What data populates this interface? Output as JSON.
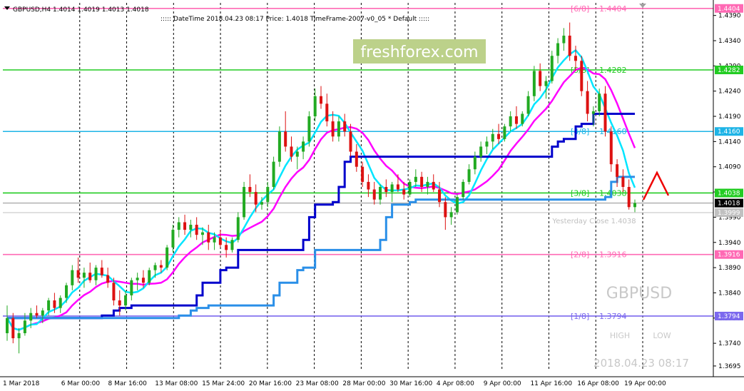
{
  "header": {
    "symbol_line": "GBPUSD,H4  1.4014 1.4019 1.4013 1.4018",
    "info_line": "::::: DateTime  2018.04.23 08:17    Price: 1.4018    TimeFrame-2007-v0_05    *   Default   :::::"
  },
  "watermark": "freshforex.com",
  "symbol_name": "GBPUSD",
  "timestamp": "2018.04.23 08:17",
  "high_label": "HIGH",
  "low_label": "LOW",
  "yesterday_close": "Yesterday Close 1.4038",
  "colors": {
    "bull": "#22aa22",
    "bear": "#dd1111",
    "cyan": "#00e5ff",
    "magenta": "#ff00ff",
    "navy": "#0000cc",
    "sky": "#2a8fe8",
    "red": "#ee0000"
  },
  "chart_data": {
    "type": "candlestick",
    "symbol": "GBPUSD",
    "timeframe": "H4",
    "ylim": [
      1.3685,
      1.4415
    ],
    "y_ticks": [
      "1.4390",
      "1.4340",
      "1.4290",
      "1.4240",
      "1.4190",
      "1.4140",
      "1.4090",
      "1.4040",
      "1.3990",
      "1.3940",
      "1.3890",
      "1.3840",
      "1.3790",
      "1.3740",
      "1.3695"
    ],
    "x_ticks": [
      "1 Mar 2018",
      "6 Mar 00:00",
      "8 Mar 16:00",
      "13 Mar 08:00",
      "15 Mar 24:00",
      "20 Mar 16:00",
      "23 Mar 08:00",
      "28 Mar 00:00",
      "30 Mar 16:00",
      "4 Apr 08:00",
      "9 Apr 00:00",
      "11 Apr 16:00",
      "16 Apr 08:00",
      "19 Apr 00:00"
    ],
    "levels": [
      {
        "label": "[6/8]",
        "value": "1.4404",
        "color": "#ff69b4",
        "tag": "1.4404"
      },
      {
        "label": "[5/8]",
        "value": "1.4282",
        "color": "#22cc22",
        "tag": "1.4282"
      },
      {
        "label": "[4/8]",
        "value": "1.4160",
        "color": "#1eb4e6",
        "tag": "1.4160"
      },
      {
        "label": "[3/8]",
        "value": "1.4038",
        "color": "#22cc22",
        "tag": "1.4038"
      },
      {
        "label": "[2/8]",
        "value": "1.3916",
        "color": "#ff69b4",
        "tag": "1.3916"
      },
      {
        "label": "[1/8]",
        "value": "1.3794",
        "color": "#7b68ee",
        "tag": "1.3794"
      }
    ],
    "price_tags": [
      {
        "value": "1.4018",
        "bg": "#000000"
      },
      {
        "value": "1.3999",
        "bg": "#c0c0c0"
      }
    ],
    "current_price": 1.4018,
    "yesterday_close": 1.3999,
    "candles": [
      [
        1.376,
        1.3815,
        1.3745,
        1.379
      ],
      [
        1.379,
        1.38,
        1.374,
        1.375
      ],
      [
        1.375,
        1.377,
        1.372,
        1.376
      ],
      [
        1.376,
        1.38,
        1.3755,
        1.3785
      ],
      [
        1.3785,
        1.381,
        1.377,
        1.38
      ],
      [
        1.38,
        1.3815,
        1.379,
        1.3795
      ],
      [
        1.3795,
        1.381,
        1.378,
        1.3805
      ],
      [
        1.3805,
        1.383,
        1.3795,
        1.3825
      ],
      [
        1.3825,
        1.384,
        1.38,
        1.381
      ],
      [
        1.381,
        1.3835,
        1.38,
        1.383
      ],
      [
        1.383,
        1.386,
        1.382,
        1.3855
      ],
      [
        1.3855,
        1.3895,
        1.3845,
        1.3885
      ],
      [
        1.3885,
        1.391,
        1.386,
        1.387
      ],
      [
        1.387,
        1.389,
        1.385,
        1.388
      ],
      [
        1.388,
        1.39,
        1.386,
        1.3865
      ],
      [
        1.3865,
        1.3895,
        1.3855,
        1.389
      ],
      [
        1.389,
        1.3905,
        1.387,
        1.3875
      ],
      [
        1.3875,
        1.389,
        1.385,
        1.386
      ],
      [
        1.386,
        1.387,
        1.3815,
        1.3825
      ],
      [
        1.3825,
        1.3845,
        1.3795,
        1.3815
      ],
      [
        1.3815,
        1.3845,
        1.3805,
        1.3835
      ],
      [
        1.3835,
        1.387,
        1.3825,
        1.3865
      ],
      [
        1.3865,
        1.388,
        1.3845,
        1.387
      ],
      [
        1.387,
        1.3885,
        1.385,
        1.386
      ],
      [
        1.386,
        1.389,
        1.3855,
        1.3885
      ],
      [
        1.3885,
        1.39,
        1.387,
        1.3895
      ],
      [
        1.3895,
        1.3905,
        1.388,
        1.389
      ],
      [
        1.389,
        1.3935,
        1.3885,
        1.393
      ],
      [
        1.393,
        1.3975,
        1.392,
        1.3965
      ],
      [
        1.3965,
        1.399,
        1.395,
        1.398
      ],
      [
        1.398,
        1.3995,
        1.3955,
        1.3965
      ],
      [
        1.3965,
        1.3985,
        1.395,
        1.3975
      ],
      [
        1.3975,
        1.399,
        1.3945,
        1.3955
      ],
      [
        1.3955,
        1.397,
        1.3935,
        1.396
      ],
      [
        1.396,
        1.3975,
        1.3925,
        1.394
      ],
      [
        1.394,
        1.396,
        1.3925,
        1.395
      ],
      [
        1.395,
        1.3965,
        1.393,
        1.3935
      ],
      [
        1.3935,
        1.395,
        1.391,
        1.3925
      ],
      [
        1.3925,
        1.395,
        1.392,
        1.3945
      ],
      [
        1.3945,
        1.4,
        1.394,
        1.399
      ],
      [
        1.399,
        1.406,
        1.3985,
        1.405
      ],
      [
        1.405,
        1.4075,
        1.403,
        1.404
      ],
      [
        1.404,
        1.4055,
        1.4,
        1.4015
      ],
      [
        1.4015,
        1.403,
        1.4005,
        1.402
      ],
      [
        1.402,
        1.406,
        1.401,
        1.405
      ],
      [
        1.405,
        1.411,
        1.4045,
        1.41
      ],
      [
        1.41,
        1.417,
        1.409,
        1.416
      ],
      [
        1.416,
        1.42,
        1.412,
        1.413
      ],
      [
        1.413,
        1.415,
        1.41,
        1.411
      ],
      [
        1.411,
        1.413,
        1.4085,
        1.412
      ],
      [
        1.412,
        1.415,
        1.4105,
        1.414
      ],
      [
        1.414,
        1.42,
        1.413,
        1.419
      ],
      [
        1.419,
        1.4245,
        1.418,
        1.423
      ],
      [
        1.423,
        1.425,
        1.4205,
        1.4215
      ],
      [
        1.4215,
        1.4235,
        1.417,
        1.418
      ],
      [
        1.418,
        1.42,
        1.414,
        1.415
      ],
      [
        1.415,
        1.419,
        1.414,
        1.418
      ],
      [
        1.418,
        1.4195,
        1.415,
        1.416
      ],
      [
        1.416,
        1.4175,
        1.411,
        1.412
      ],
      [
        1.412,
        1.4135,
        1.408,
        1.409
      ],
      [
        1.409,
        1.41,
        1.405,
        1.406
      ],
      [
        1.406,
        1.4075,
        1.403,
        1.4045
      ],
      [
        1.4045,
        1.406,
        1.4015,
        1.4025
      ],
      [
        1.4025,
        1.4055,
        1.4015,
        1.405
      ],
      [
        1.405,
        1.4065,
        1.403,
        1.404
      ],
      [
        1.404,
        1.406,
        1.402,
        1.4055
      ],
      [
        1.4055,
        1.4075,
        1.404,
        1.4045
      ],
      [
        1.4045,
        1.406,
        1.4025,
        1.4035
      ],
      [
        1.4035,
        1.4065,
        1.403,
        1.406
      ],
      [
        1.406,
        1.4085,
        1.405,
        1.407
      ],
      [
        1.407,
        1.408,
        1.404,
        1.405
      ],
      [
        1.405,
        1.407,
        1.4035,
        1.406
      ],
      [
        1.406,
        1.4075,
        1.404,
        1.4045
      ],
      [
        1.4045,
        1.406,
        1.401,
        1.402
      ],
      [
        1.402,
        1.403,
        1.3965,
        1.399
      ],
      [
        1.399,
        1.401,
        1.3975,
        1.4
      ],
      [
        1.4,
        1.4035,
        1.3995,
        1.403
      ],
      [
        1.403,
        1.4065,
        1.4025,
        1.406
      ],
      [
        1.406,
        1.4095,
        1.4055,
        1.4085
      ],
      [
        1.4085,
        1.412,
        1.4075,
        1.411
      ],
      [
        1.411,
        1.414,
        1.41,
        1.413
      ],
      [
        1.413,
        1.415,
        1.4115,
        1.414
      ],
      [
        1.414,
        1.4165,
        1.4125,
        1.4155
      ],
      [
        1.4155,
        1.4175,
        1.4135,
        1.4145
      ],
      [
        1.4145,
        1.4175,
        1.414,
        1.417
      ],
      [
        1.417,
        1.42,
        1.416,
        1.419
      ],
      [
        1.419,
        1.421,
        1.4165,
        1.4175
      ],
      [
        1.4175,
        1.42,
        1.417,
        1.4195
      ],
      [
        1.4195,
        1.424,
        1.419,
        1.423
      ],
      [
        1.423,
        1.429,
        1.422,
        1.428
      ],
      [
        1.428,
        1.4295,
        1.424,
        1.425
      ],
      [
        1.425,
        1.427,
        1.4225,
        1.426
      ],
      [
        1.426,
        1.432,
        1.4255,
        1.431
      ],
      [
        1.431,
        1.4345,
        1.4295,
        1.4335
      ],
      [
        1.4335,
        1.4365,
        1.432,
        1.435
      ],
      [
        1.435,
        1.4376,
        1.43,
        1.431
      ],
      [
        1.431,
        1.433,
        1.428,
        1.43
      ],
      [
        1.43,
        1.431,
        1.423,
        1.424
      ],
      [
        1.424,
        1.426,
        1.418,
        1.4195
      ],
      [
        1.4195,
        1.421,
        1.417,
        1.42
      ],
      [
        1.42,
        1.4245,
        1.419,
        1.4235
      ],
      [
        1.4235,
        1.425,
        1.415,
        1.416
      ],
      [
        1.416,
        1.417,
        1.408,
        1.4095
      ],
      [
        1.4095,
        1.4105,
        1.405,
        1.407
      ],
      [
        1.407,
        1.4085,
        1.404,
        1.405
      ],
      [
        1.405,
        1.4065,
        1.4005,
        1.401
      ],
      [
        1.401,
        1.4025,
        1.4,
        1.4018
      ]
    ]
  }
}
